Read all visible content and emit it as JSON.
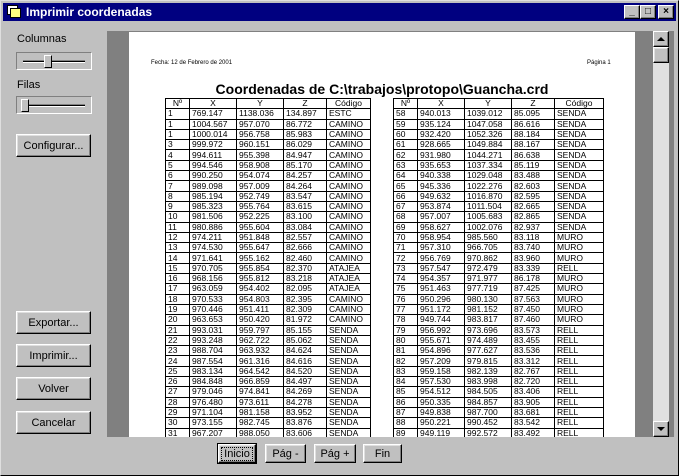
{
  "window": {
    "title": "Imprimir coordenadas",
    "min_glyph": "_",
    "max_glyph": "□",
    "close_glyph": "×"
  },
  "sidebar": {
    "columnas_label": "Columnas",
    "columnas_level": 0.4,
    "filas_label": "Filas",
    "filas_level": 0.0,
    "configurar": "Configurar...",
    "exportar": "Exportar...",
    "imprimir": "Imprimir...",
    "volver": "Volver",
    "cancelar": "Cancelar"
  },
  "nav": {
    "inicio": "Inicio",
    "prev": "Pág -",
    "next": "Pág +",
    "fin": "Fin"
  },
  "page": {
    "date": "Fecha: 12 de Febrero de 2001",
    "page_no": "Página 1",
    "title": "Coordenadas de C:\\trabajos\\protopo\\Guancha.crd",
    "headers": [
      "Nº",
      "X",
      "Y",
      "Z",
      "Código"
    ],
    "left_rows": [
      [
        "1",
        "769.147",
        "1138.036",
        "134.897",
        "ESTC"
      ],
      [
        "1",
        "1004.567",
        "957.070",
        "86.772",
        "CAMINO"
      ],
      [
        "1",
        "1000.014",
        "956.758",
        "85.983",
        "CAMINO"
      ],
      [
        "3",
        "999.972",
        "960.151",
        "86.029",
        "CAMINO"
      ],
      [
        "4",
        "994.611",
        "955.398",
        "84.947",
        "CAMINO"
      ],
      [
        "5",
        "994.546",
        "958.908",
        "85.170",
        "CAMINO"
      ],
      [
        "6",
        "990.250",
        "954.074",
        "84.257",
        "CAMINO"
      ],
      [
        "7",
        "989.098",
        "957.009",
        "84.264",
        "CAMINO"
      ],
      [
        "8",
        "985.194",
        "952.749",
        "83.547",
        "CAMINO"
      ],
      [
        "9",
        "985.323",
        "955.764",
        "83.615",
        "CAMINO"
      ],
      [
        "10",
        "981.506",
        "952.225",
        "83.100",
        "CAMINO"
      ],
      [
        "11",
        "980.886",
        "955.604",
        "83.084",
        "CAMINO"
      ],
      [
        "12",
        "974.211",
        "951.848",
        "82.557",
        "CAMINO"
      ],
      [
        "13",
        "974.530",
        "955.647",
        "82.666",
        "CAMINO"
      ],
      [
        "14",
        "971.641",
        "955.162",
        "82.460",
        "CAMINO"
      ],
      [
        "15",
        "970.705",
        "955.854",
        "82.370",
        "ATAJEA"
      ],
      [
        "16",
        "968.156",
        "955.812",
        "83.218",
        "ATAJEA"
      ],
      [
        "17",
        "963.059",
        "954.402",
        "82.095",
        "ATAJEA"
      ],
      [
        "18",
        "970.533",
        "954.803",
        "82.395",
        "CAMINO"
      ],
      [
        "19",
        "970.446",
        "951.411",
        "82.309",
        "CAMINO"
      ],
      [
        "20",
        "963.653",
        "950.420",
        "81.972",
        "CAMINO"
      ],
      [
        "21",
        "993.031",
        "959.797",
        "85.155",
        "SENDA"
      ],
      [
        "22",
        "993.248",
        "962.722",
        "85.062",
        "SENDA"
      ],
      [
        "23",
        "988.704",
        "963.932",
        "84.624",
        "SENDA"
      ],
      [
        "24",
        "987.554",
        "961.316",
        "84.616",
        "SENDA"
      ],
      [
        "25",
        "983.134",
        "964.542",
        "84.520",
        "SENDA"
      ],
      [
        "26",
        "984.848",
        "966.859",
        "84.497",
        "SENDA"
      ],
      [
        "27",
        "979.046",
        "974.841",
        "84.269",
        "SENDA"
      ],
      [
        "28",
        "976.480",
        "973.611",
        "84.278",
        "SENDA"
      ],
      [
        "29",
        "971.104",
        "981.158",
        "83.952",
        "SENDA"
      ],
      [
        "30",
        "973.155",
        "982.745",
        "83.876",
        "SENDA"
      ],
      [
        "31",
        "967.207",
        "988.050",
        "83.606",
        "SENDA"
      ]
    ],
    "right_rows": [
      [
        "58",
        "940.013",
        "1039.012",
        "85.095",
        "SENDA"
      ],
      [
        "59",
        "935.124",
        "1047.058",
        "86.616",
        "SENDA"
      ],
      [
        "60",
        "932.420",
        "1052.326",
        "88.184",
        "SENDA"
      ],
      [
        "61",
        "928.665",
        "1049.884",
        "88.167",
        "SENDA"
      ],
      [
        "62",
        "931.980",
        "1044.271",
        "86.638",
        "SENDA"
      ],
      [
        "63",
        "935.653",
        "1037.334",
        "85.119",
        "SENDA"
      ],
      [
        "64",
        "940.338",
        "1029.048",
        "83.488",
        "SENDA"
      ],
      [
        "65",
        "945.336",
        "1022.276",
        "82.603",
        "SENDA"
      ],
      [
        "66",
        "949.632",
        "1016.870",
        "82.595",
        "SENDA"
      ],
      [
        "67",
        "953.874",
        "1011.504",
        "82.665",
        "SENDA"
      ],
      [
        "68",
        "957.007",
        "1005.683",
        "82.865",
        "SENDA"
      ],
      [
        "69",
        "958.627",
        "1002.076",
        "82.937",
        "SENDA"
      ],
      [
        "70",
        "958.954",
        "985.560",
        "83.118",
        "MURO"
      ],
      [
        "71",
        "957.310",
        "966.705",
        "83.740",
        "MURO"
      ],
      [
        "72",
        "956.769",
        "970.862",
        "83.960",
        "MURO"
      ],
      [
        "73",
        "957.547",
        "972.479",
        "83.339",
        "RELL"
      ],
      [
        "74",
        "954.357",
        "971.977",
        "86.178",
        "MURO"
      ],
      [
        "75",
        "951.463",
        "977.719",
        "87.425",
        "MURO"
      ],
      [
        "76",
        "950.296",
        "980.130",
        "87.563",
        "MURO"
      ],
      [
        "77",
        "951.172",
        "981.152",
        "87.450",
        "MURO"
      ],
      [
        "78",
        "949.744",
        "983.817",
        "87.460",
        "MURO"
      ],
      [
        "79",
        "956.992",
        "973.696",
        "83.573",
        "RELL"
      ],
      [
        "80",
        "955.671",
        "974.489",
        "83.455",
        "RELL"
      ],
      [
        "81",
        "954.896",
        "977.627",
        "83.536",
        "RELL"
      ],
      [
        "82",
        "957.209",
        "979.815",
        "83.312",
        "RELL"
      ],
      [
        "83",
        "959.158",
        "982.139",
        "82.767",
        "RELL"
      ],
      [
        "84",
        "957.530",
        "983.998",
        "82.720",
        "RELL"
      ],
      [
        "85",
        "954.512",
        "984.505",
        "83.406",
        "RELL"
      ],
      [
        "86",
        "950.335",
        "984.857",
        "83.905",
        "RELL"
      ],
      [
        "87",
        "949.838",
        "987.700",
        "83.681",
        "RELL"
      ],
      [
        "88",
        "950.221",
        "990.452",
        "83.542",
        "RELL"
      ],
      [
        "89",
        "949.119",
        "992.572",
        "83.492",
        "RELL"
      ]
    ]
  }
}
